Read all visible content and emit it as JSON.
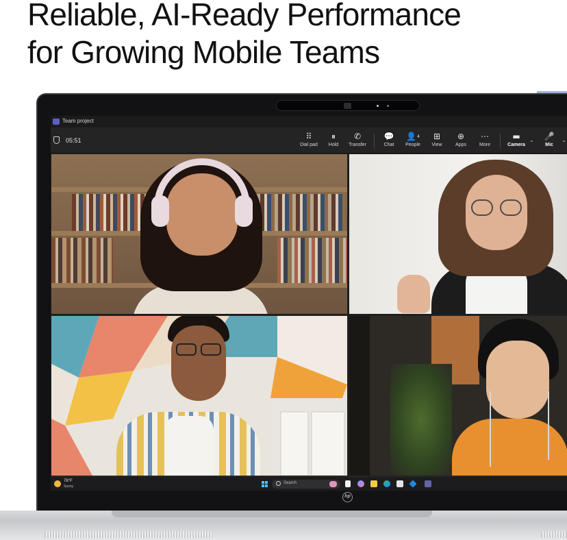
{
  "headline": {
    "line1": "Reliable, AI-Ready Performance",
    "line2": "for Growing Mobile Teams"
  },
  "window": {
    "title": "Team project",
    "app_icon": "teams-icon"
  },
  "call_toolbar": {
    "timer": "05:51",
    "tools": [
      {
        "label": "Dial pad",
        "icon": "dialpad-icon",
        "glyph": "⠿"
      },
      {
        "label": "Hold",
        "icon": "pause-icon",
        "glyph": "⏸"
      },
      {
        "label": "Transfer",
        "icon": "phone-transfer-icon",
        "glyph": "✆"
      },
      {
        "label": "Chat",
        "icon": "chat-icon",
        "glyph": "💬"
      },
      {
        "label": "People",
        "icon": "people-icon",
        "glyph": "👤",
        "count": "4"
      },
      {
        "label": "View",
        "icon": "view-grid-icon",
        "glyph": "⊞"
      },
      {
        "label": "Apps",
        "icon": "apps-add-icon",
        "glyph": "⊕"
      },
      {
        "label": "More",
        "icon": "more-icon",
        "glyph": "⋯"
      },
      {
        "label": "Camera",
        "icon": "camera-icon",
        "glyph": "▬"
      },
      {
        "label": "Mic",
        "icon": "mic-icon",
        "glyph": "🎤"
      }
    ]
  },
  "taskbar": {
    "weather_temp": "78°F",
    "weather_condition": "Sunny",
    "search_placeholder": "Search"
  },
  "colors": {
    "teams_purple": "#5b5fc7",
    "toolbar_bg": "#242424",
    "windows_blue": "#4cc2ff"
  }
}
